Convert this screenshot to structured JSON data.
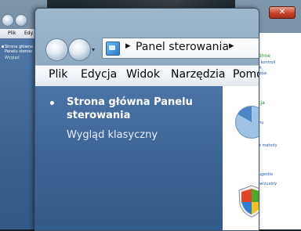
{
  "main_window": {
    "breadcrumb": "Panel sterowania",
    "menu": [
      "Plik",
      "Edycja",
      "Widok",
      "Narzędzia",
      "Pomoc"
    ],
    "tasks": {
      "home_link": "Strona główna Panelu sterowania",
      "classic_link": "Wygląd klasyczny"
    }
  },
  "back_window_left": {
    "menu": [
      "Plik",
      "Edy"
    ],
    "tasks": {
      "home_link": "Strona główna Panelu sterow",
      "classic_link": "Wygląd"
    }
  },
  "back_window_right": {
    "lines": [
      {
        "text": "ków",
        "style": "g"
      },
      {
        "text": "rodzinne",
        "style": "g"
      },
      {
        "text": "iania kontroli",
        "style": "b"
      },
      {
        "text": "ących",
        "style": "b"
      },
      {
        "text": "ywidzów",
        "style": "b"
      },
      {
        "text": "lizacja",
        "style": "g"
      },
      {
        "text": "ekranu",
        "style": "b"
      },
      {
        "text": "ion",
        "style": "g"
      },
      {
        "text": "ponie metody",
        "style": "b"
      },
      {
        "text": "su",
        "style": "g"
      },
      {
        "text": "tuj sugestie",
        "style": "b"
      },
      {
        "text": "dczr wizualny",
        "style": "b"
      }
    ]
  },
  "icons": {
    "nav": [
      "back-arrow-icon",
      "forward-arrow-icon",
      "recent-pages-dropdown-icon"
    ],
    "address": "control-panel-icon",
    "content": [
      "appearance-pie-icon",
      "security-shield-icon"
    ]
  },
  "colors": {
    "task_pane": "#3a6394",
    "menu_bar": "#eef2f7",
    "close_button": "#c8432a"
  }
}
